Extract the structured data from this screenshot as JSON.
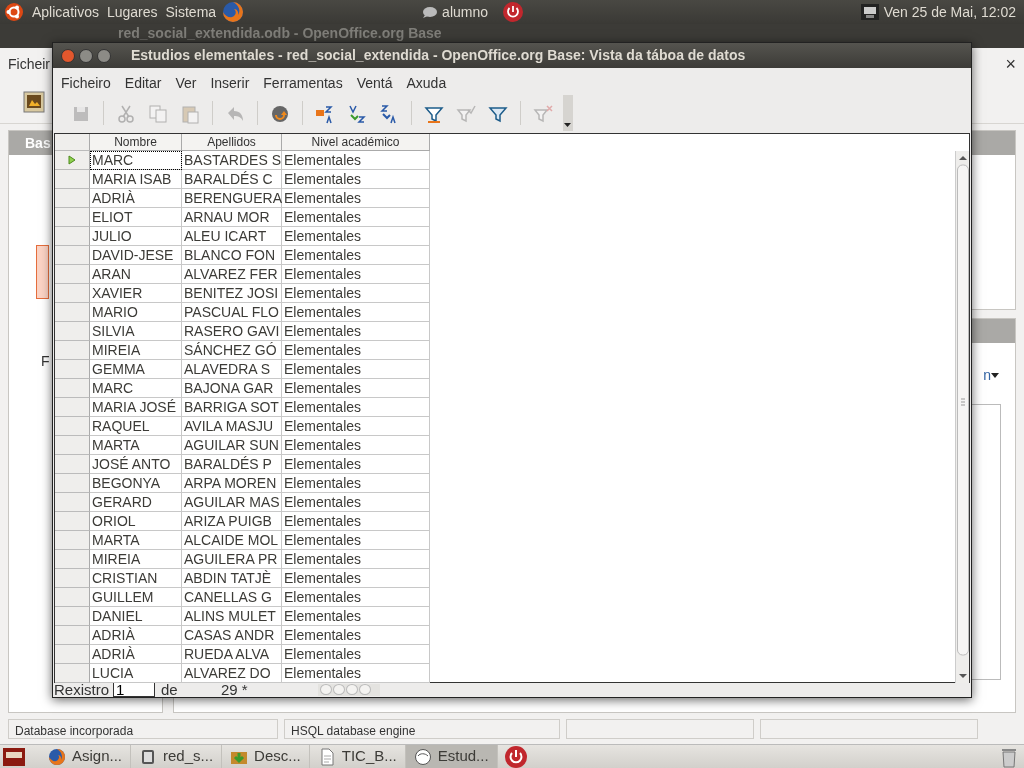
{
  "top_panel": {
    "menus": [
      "Aplicativos",
      "Lugares",
      "Sistema"
    ],
    "user": "alumno",
    "clock": "Ven 25 de Mai, 12:02"
  },
  "background_window": {
    "title": "red_social_extendida.odb - OpenOffice.org Base",
    "menu": [
      "Ficheir"
    ],
    "close": "×",
    "sidebar_header": "Bas",
    "sidebar_letter": "F",
    "panel_letter": "n",
    "status_bar": [
      "Database incorporada",
      "HSQL database engine"
    ]
  },
  "front_window": {
    "title": "Estudios elementales - red_social_extendida - OpenOffice.org Base: Vista da táboa de datos",
    "menu": [
      "Ficheiro",
      "Editar",
      "Ver",
      "Inserir",
      "Ferramentas",
      "Ventá",
      "Axuda"
    ],
    "toolbar": [
      {
        "kind": "button",
        "disabled": true
      },
      {
        "kind": "separator"
      },
      {
        "kind": "button",
        "disabled": true
      },
      {
        "kind": "button",
        "disabled": true
      },
      {
        "kind": "button",
        "disabled": true
      },
      {
        "kind": "separator"
      },
      {
        "kind": "button",
        "disabled": true
      },
      {
        "kind": "separator"
      },
      {
        "kind": "button",
        "disabled": false
      },
      {
        "kind": "separator"
      },
      {
        "kind": "button",
        "disabled": false
      },
      {
        "kind": "button",
        "disabled": false
      },
      {
        "kind": "button",
        "disabled": false
      },
      {
        "kind": "separator"
      },
      {
        "kind": "button",
        "disabled": false
      },
      {
        "kind": "button",
        "disabled": true
      },
      {
        "kind": "button",
        "disabled": false
      },
      {
        "kind": "separator"
      },
      {
        "kind": "button",
        "disabled": true
      }
    ],
    "table": {
      "columns": [
        "Nombre",
        "Apellidos",
        "Nivel académico"
      ],
      "rows": [
        {
          "selected": true,
          "cells": [
            "MARC",
            "BASTARDES S",
            "Elementales"
          ]
        },
        {
          "selected": false,
          "cells": [
            "MARIA ISAB",
            "BARALDÉS C",
            "Elementales"
          ]
        },
        {
          "selected": false,
          "cells": [
            "ADRIÀ",
            "BERENGUERA",
            "Elementales"
          ]
        },
        {
          "selected": false,
          "cells": [
            "ELIOT",
            "ARNAU MOR",
            "Elementales"
          ]
        },
        {
          "selected": false,
          "cells": [
            "JULIO",
            "ALEU ICART",
            "Elementales"
          ]
        },
        {
          "selected": false,
          "cells": [
            "DAVID-JESE",
            "BLANCO FON",
            "Elementales"
          ]
        },
        {
          "selected": false,
          "cells": [
            "ARAN",
            "ALVAREZ FER",
            "Elementales"
          ]
        },
        {
          "selected": false,
          "cells": [
            "XAVIER",
            "BENITEZ JOSI",
            "Elementales"
          ]
        },
        {
          "selected": false,
          "cells": [
            "MARIO",
            "PASCUAL FLO",
            "Elementales"
          ]
        },
        {
          "selected": false,
          "cells": [
            "SILVIA",
            "RASERO GAVI",
            "Elementales"
          ]
        },
        {
          "selected": false,
          "cells": [
            "MIREIA",
            "SÁNCHEZ GÓ",
            "Elementales"
          ]
        },
        {
          "selected": false,
          "cells": [
            "GEMMA",
            "ALAVEDRA S",
            "Elementales"
          ]
        },
        {
          "selected": false,
          "cells": [
            "MARC",
            "BAJONA GAR",
            "Elementales"
          ]
        },
        {
          "selected": false,
          "cells": [
            "MARIA JOSÉ",
            "BARRIGA SOT",
            "Elementales"
          ]
        },
        {
          "selected": false,
          "cells": [
            "RAQUEL",
            "AVILA MASJU",
            "Elementales"
          ]
        },
        {
          "selected": false,
          "cells": [
            "MARTA",
            "AGUILAR SUN",
            "Elementales"
          ]
        },
        {
          "selected": false,
          "cells": [
            "JOSÉ ANTO",
            "BARALDÉS P",
            "Elementales"
          ]
        },
        {
          "selected": false,
          "cells": [
            "BEGONYA",
            "ARPA MOREN",
            "Elementales"
          ]
        },
        {
          "selected": false,
          "cells": [
            "GERARD",
            "AGUILAR MAS",
            "Elementales"
          ]
        },
        {
          "selected": false,
          "cells": [
            "ORIOL",
            "ARIZA PUIGB",
            "Elementales"
          ]
        },
        {
          "selected": false,
          "cells": [
            "MARTA",
            "ALCAIDE MOL",
            "Elementales"
          ]
        },
        {
          "selected": false,
          "cells": [
            "MIREIA",
            "AGUILERA PR",
            "Elementales"
          ]
        },
        {
          "selected": false,
          "cells": [
            "CRISTIAN",
            "ABDIN TATJÈ",
            "Elementales"
          ]
        },
        {
          "selected": false,
          "cells": [
            "GUILLEM",
            "CANELLAS G",
            "Elementales"
          ]
        },
        {
          "selected": false,
          "cells": [
            "DANIEL",
            "ALINS MULET",
            "Elementales"
          ]
        },
        {
          "selected": false,
          "cells": [
            "ADRIÀ",
            "CASAS ANDR",
            "Elementales"
          ]
        },
        {
          "selected": false,
          "cells": [
            "ADRIÀ",
            "RUEDA ALVA",
            "Elementales"
          ]
        },
        {
          "selected": false,
          "cells": [
            "LUCIA",
            "ALVAREZ DO",
            "Elementales"
          ]
        }
      ]
    },
    "navigator": {
      "label": "Rexistro",
      "current": "1",
      "of": "de",
      "total": "29 *"
    }
  },
  "taskbar": [
    {
      "label": "Asign...",
      "selected": false
    },
    {
      "label": "red_s...",
      "selected": false
    },
    {
      "label": "Desc...",
      "selected": false
    },
    {
      "label": "TIC_B...",
      "selected": false
    },
    {
      "label": "Estud...",
      "selected": true
    }
  ]
}
